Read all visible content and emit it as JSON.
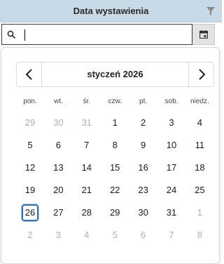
{
  "header": {
    "title": "Data wystawienia"
  },
  "search": {
    "value": ""
  },
  "calendar": {
    "month_label": "styczeń 2026",
    "weekdays": [
      "pon.",
      "wt.",
      "śr.",
      "czw.",
      "pt.",
      "sob.",
      "niedz."
    ],
    "weeks": [
      [
        {
          "d": "29",
          "o": true
        },
        {
          "d": "30",
          "o": true
        },
        {
          "d": "31",
          "o": true
        },
        {
          "d": "1"
        },
        {
          "d": "2"
        },
        {
          "d": "3"
        },
        {
          "d": "4"
        }
      ],
      [
        {
          "d": "5"
        },
        {
          "d": "6"
        },
        {
          "d": "7"
        },
        {
          "d": "8"
        },
        {
          "d": "9"
        },
        {
          "d": "10"
        },
        {
          "d": "11"
        }
      ],
      [
        {
          "d": "12"
        },
        {
          "d": "13"
        },
        {
          "d": "14"
        },
        {
          "d": "15"
        },
        {
          "d": "16"
        },
        {
          "d": "17"
        },
        {
          "d": "18"
        }
      ],
      [
        {
          "d": "19"
        },
        {
          "d": "20"
        },
        {
          "d": "21"
        },
        {
          "d": "22"
        },
        {
          "d": "23"
        },
        {
          "d": "24"
        },
        {
          "d": "25"
        }
      ],
      [
        {
          "d": "26",
          "today": true
        },
        {
          "d": "27"
        },
        {
          "d": "28"
        },
        {
          "d": "29"
        },
        {
          "d": "30"
        },
        {
          "d": "31"
        },
        {
          "d": "1",
          "o": true
        }
      ],
      [
        {
          "d": "2",
          "o": true
        },
        {
          "d": "3",
          "o": true
        },
        {
          "d": "4",
          "o": true
        },
        {
          "d": "5",
          "o": true
        },
        {
          "d": "6",
          "o": true
        },
        {
          "d": "7",
          "o": true
        },
        {
          "d": "8",
          "o": true
        }
      ]
    ]
  },
  "colors": {
    "header_bg": "#c9d9e6",
    "today_border": "#3a6fa8",
    "other_month": "#b0b0b0"
  }
}
